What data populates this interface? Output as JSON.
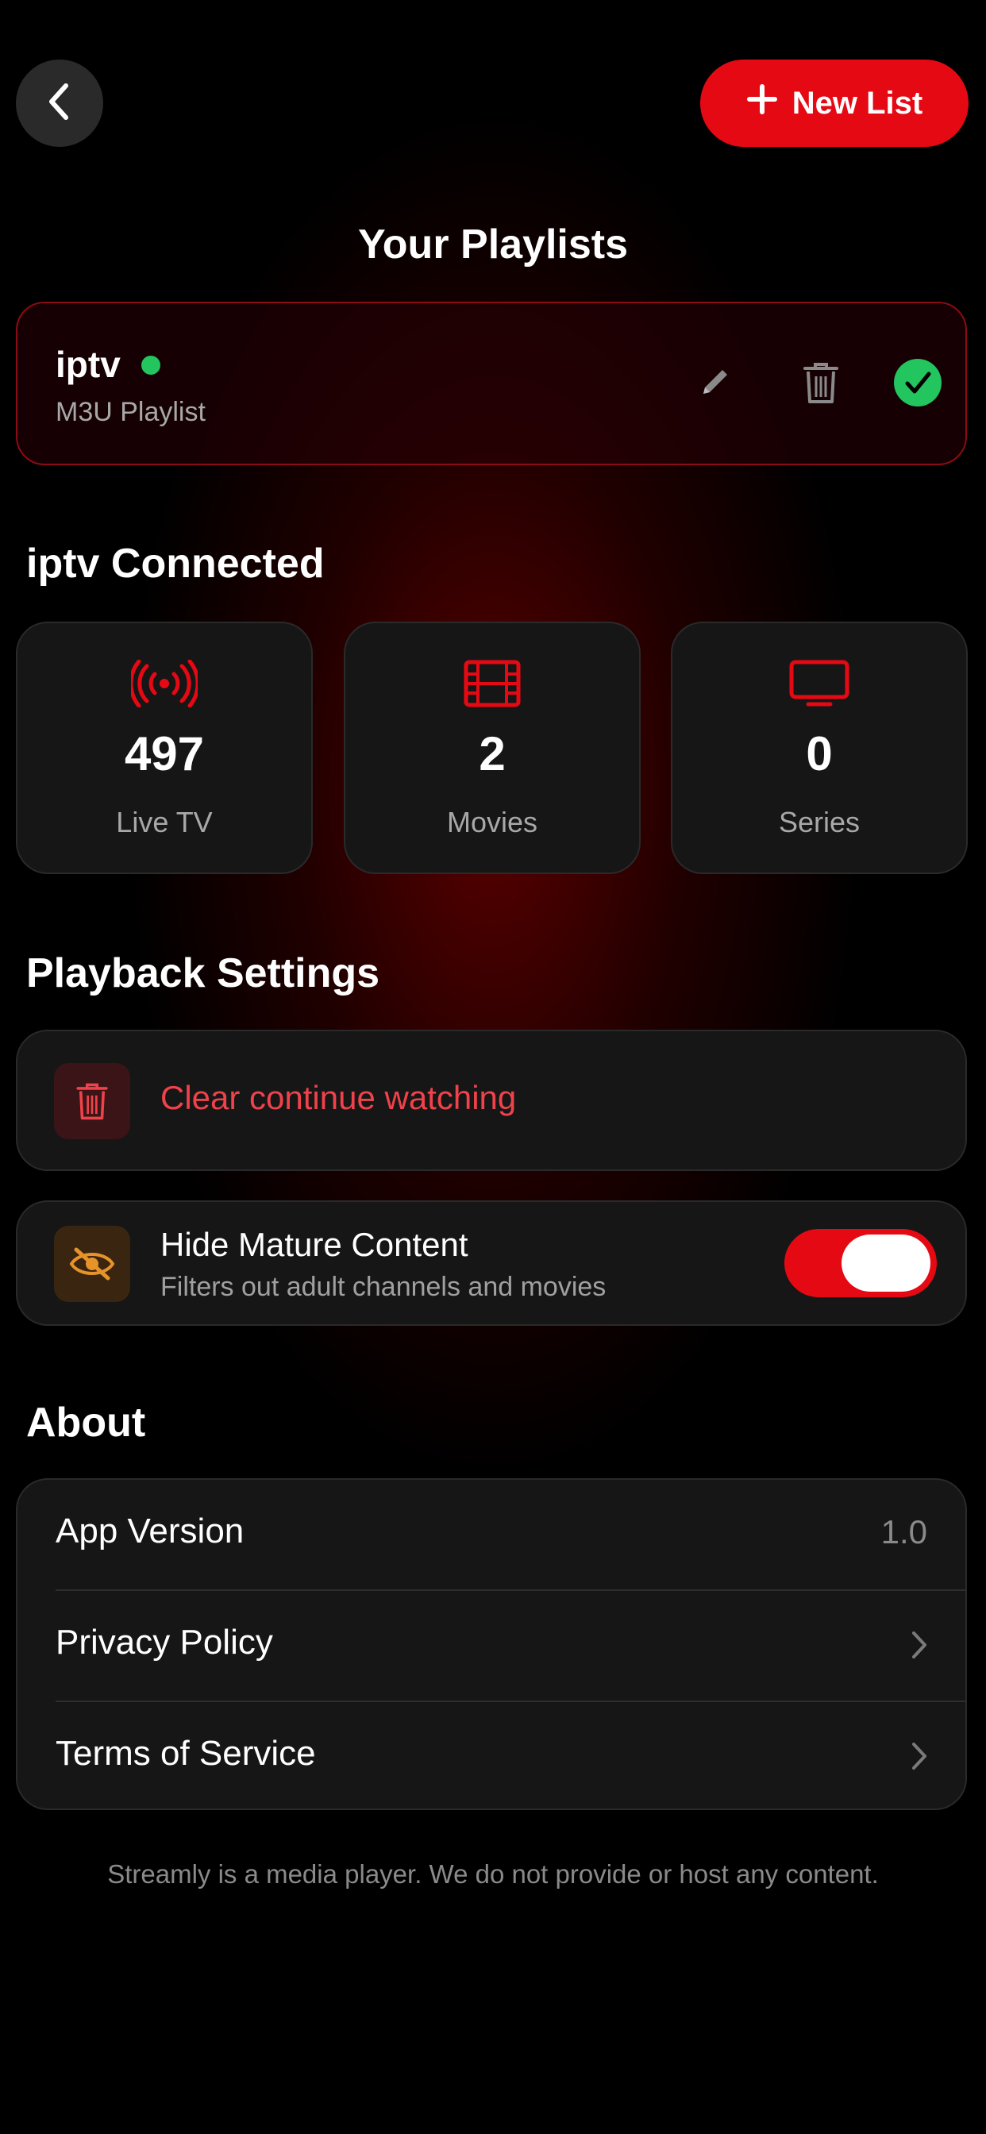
{
  "header": {
    "back_icon": "chevron-left-icon",
    "new_list_label": "New List",
    "new_list_icon": "plus-icon"
  },
  "page_title": "Your Playlists",
  "playlist": {
    "name": "iptv",
    "type": "M3U Playlist",
    "status_color": "#22c55e",
    "edit_icon": "pencil-icon",
    "delete_icon": "trash-icon",
    "active_icon": "checkmark-icon"
  },
  "connection": {
    "title": "iptv Connected",
    "stats": [
      {
        "icon": "broadcast-icon",
        "value": "497",
        "label": "Live TV"
      },
      {
        "icon": "film-icon",
        "value": "2",
        "label": "Movies"
      },
      {
        "icon": "tv-icon",
        "value": "0",
        "label": "Series"
      }
    ]
  },
  "playback": {
    "title": "Playback Settings",
    "clear_label": "Clear continue watching",
    "hide_title": "Hide Mature Content",
    "hide_subtitle": "Filters out adult channels and movies",
    "hide_enabled": true
  },
  "about": {
    "title": "About",
    "rows": [
      {
        "label": "App Version",
        "value": "1.0"
      },
      {
        "label": "Privacy Policy"
      },
      {
        "label": "Terms of Service"
      }
    ]
  },
  "footer": "Streamly is a media player. We do not provide or host any content.",
  "colors": {
    "accent": "#e50914",
    "accent_text": "#f0424a",
    "success": "#22c55e",
    "warning": "#e8932a"
  }
}
